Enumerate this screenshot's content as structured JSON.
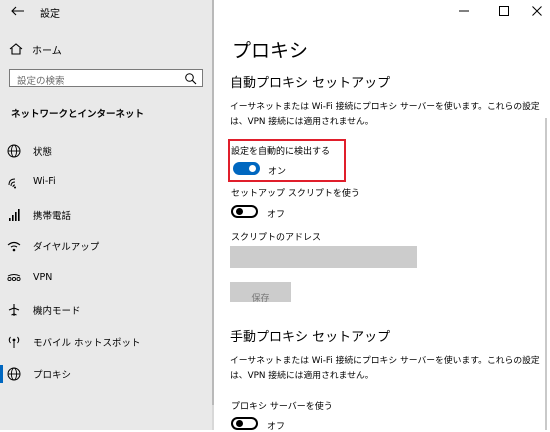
{
  "window": {
    "title": "設定"
  },
  "sidebar": {
    "home_label": "ホーム",
    "search_placeholder": "設定の検索",
    "section_title": "ネットワークとインターネット",
    "items": [
      {
        "label": "状態",
        "icon": "globe-status-icon"
      },
      {
        "label": "Wi-Fi",
        "icon": "wifi-icon"
      },
      {
        "label": "携帯電話",
        "icon": "signal-bars-icon"
      },
      {
        "label": "ダイヤルアップ",
        "icon": "dialup-icon"
      },
      {
        "label": "VPN",
        "icon": "vpn-icon"
      },
      {
        "label": "機内モード",
        "icon": "airplane-icon"
      },
      {
        "label": "モバイル ホットスポット",
        "icon": "hotspot-icon"
      },
      {
        "label": "プロキシ",
        "icon": "globe-icon",
        "active": true
      }
    ]
  },
  "main": {
    "title": "プロキシ",
    "auto": {
      "heading": "自動プロキシ セットアップ",
      "description": "イーサネットまたは Wi-Fi 接続にプロキシ サーバーを使います。これらの設定は、VPN 接続には適用されません。",
      "detect_label": "設定を自動的に検出する",
      "detect_state": "オン",
      "script_label": "セットアップ スクリプトを使う",
      "script_state": "オフ",
      "address_label": "スクリプトのアドレス",
      "address_value": "",
      "save_label": "保存"
    },
    "manual": {
      "heading": "手動プロキシ セットアップ",
      "description": "イーサネットまたは Wi-Fi 接続にプロキシ サーバーを使います。これらの設定は、VPN 接続には適用されません。",
      "use_label": "プロキシ サーバーを使う",
      "use_state": "オフ"
    }
  },
  "colors": {
    "accent": "#0067c0",
    "highlight": "#e01e2b",
    "sidebar_bg": "#e9e9e9"
  }
}
